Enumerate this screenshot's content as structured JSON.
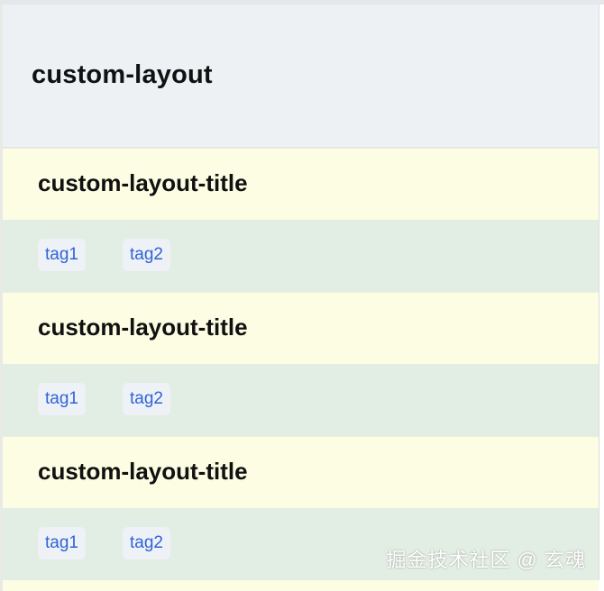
{
  "header": {
    "title": "custom-layout"
  },
  "cards": [
    {
      "title": "custom-layout-title",
      "tags": [
        "tag1",
        "tag2"
      ]
    },
    {
      "title": "custom-layout-title",
      "tags": [
        "tag1",
        "tag2"
      ]
    },
    {
      "title": "custom-layout-title",
      "tags": [
        "tag1",
        "tag2"
      ]
    }
  ],
  "watermark": "掘金技术社区 @ 玄魂",
  "colors": {
    "header_bg": "#edf1f4",
    "title_row_bg": "#fcfde3",
    "tag_row_bg": "#e2ede3",
    "tag_bg": "#eef2f6",
    "tag_text": "#2f63d8"
  }
}
